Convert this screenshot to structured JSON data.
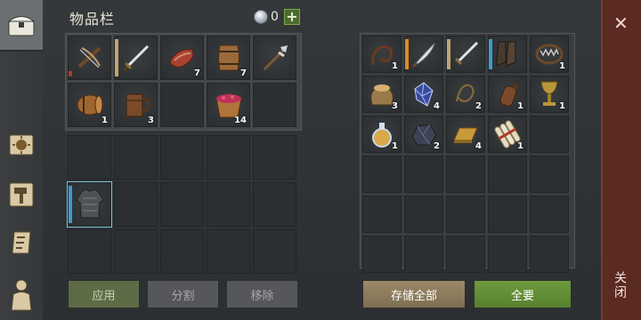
{
  "header": {
    "title": "物品栏",
    "currency_value": "0",
    "add_icon": "plus-icon"
  },
  "nav": [
    {
      "name": "inventory-chest-icon"
    },
    {
      "name": "journal-icon"
    },
    {
      "name": "crafting-hammer-icon"
    },
    {
      "name": "map-scroll-icon"
    },
    {
      "name": "character-icon"
    }
  ],
  "inventory": {
    "quick_slots": [
      {
        "icon": "crossbow-icon",
        "qty": ""
      },
      {
        "icon": "sword-icon",
        "qty": ""
      },
      {
        "icon": "meat-icon",
        "qty": "7"
      },
      {
        "icon": "barrel-icon",
        "qty": "7"
      },
      {
        "icon": "halberd-icon",
        "qty": ""
      },
      {
        "icon": "keg-icon",
        "qty": "1"
      },
      {
        "icon": "mug-icon",
        "qty": "3"
      },
      {
        "icon": "empty",
        "qty": ""
      },
      {
        "icon": "berry-bucket-icon",
        "qty": "14"
      },
      {
        "icon": "empty",
        "qty": ""
      }
    ],
    "equipped_armor": {
      "icon": "chainmail-armor-icon"
    }
  },
  "storage": {
    "slots": [
      {
        "icon": "whip-icon",
        "qty": "1"
      },
      {
        "icon": "scimitar-icon",
        "qty": ""
      },
      {
        "icon": "longsword-icon",
        "qty": ""
      },
      {
        "icon": "boots-icon",
        "qty": ""
      },
      {
        "icon": "bear-trap-icon",
        "qty": "1"
      },
      {
        "icon": "grain-sack-icon",
        "qty": "3"
      },
      {
        "icon": "crystal-icon",
        "qty": "4"
      },
      {
        "icon": "rope-icon",
        "qty": "2"
      },
      {
        "icon": "leather-flask-icon",
        "qty": "1"
      },
      {
        "icon": "goblet-icon",
        "qty": "1"
      },
      {
        "icon": "potion-icon",
        "qty": "1"
      },
      {
        "icon": "ore-icon",
        "qty": "2"
      },
      {
        "icon": "gold-ingot-icon",
        "qty": "4"
      },
      {
        "icon": "scroll-bundle-icon",
        "qty": "1"
      }
    ]
  },
  "buttons": {
    "apply": "应用",
    "split": "分割",
    "remove": "移除",
    "store_all": "存储全部",
    "take_all": "全要",
    "close": "关闭"
  },
  "colors": {
    "close_bar": "#5b2a23",
    "green_button": "#6f9b3e",
    "tan_button": "#9a8867"
  }
}
